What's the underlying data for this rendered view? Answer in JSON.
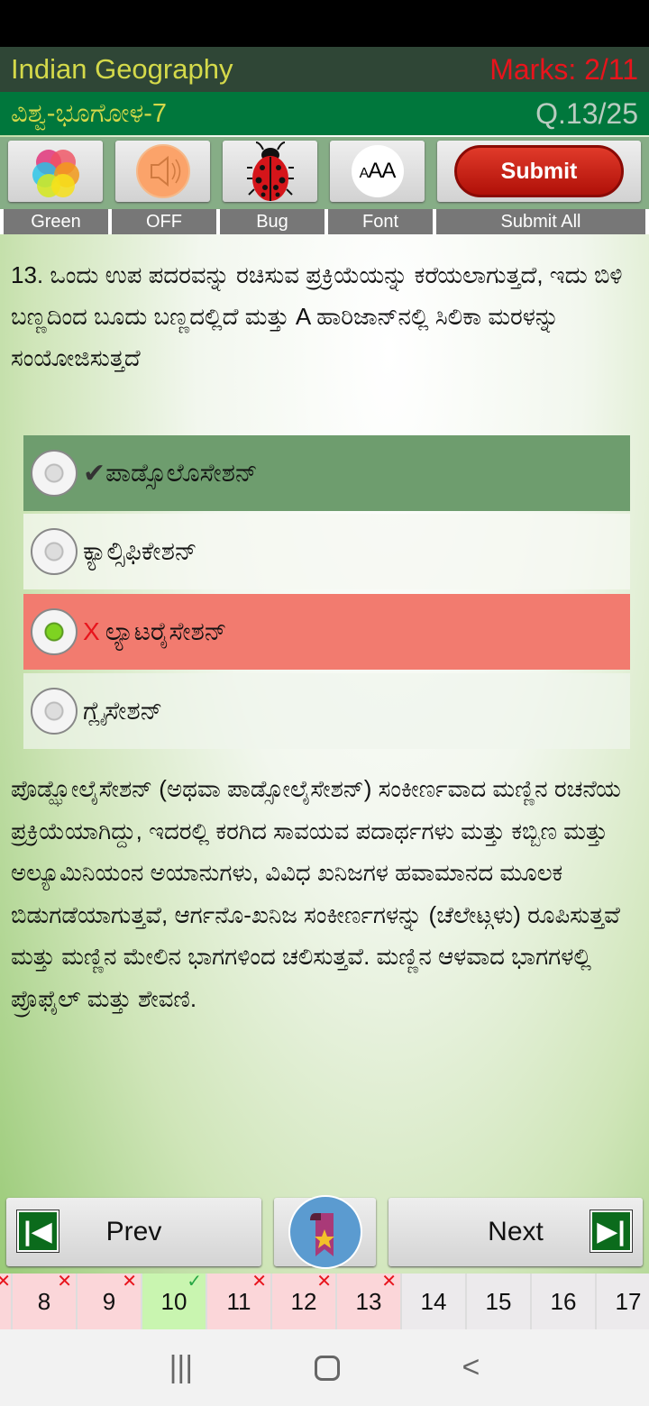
{
  "header": {
    "app_title": "Indian Geography",
    "marks": "Marks: 2/11",
    "subtitle": "ವಿಶ್ವ-ಭೂಗೋಳ-7",
    "question_counter": "Q.13/25"
  },
  "toolbar": {
    "items": [
      {
        "icon": "color-palette-icon",
        "label": "Green"
      },
      {
        "icon": "speaker-icon",
        "label": "OFF"
      },
      {
        "icon": "ladybug-icon",
        "label": "Bug"
      },
      {
        "icon": "font-size-icon",
        "icon_text": "AAA",
        "label": "Font"
      },
      {
        "button": "Submit",
        "label": "Submit All"
      }
    ]
  },
  "question": {
    "text": "13. ಒಂದು ಉಪ ಪದರವನ್ನು ರಚಿಸುವ ಪ್ರಕ್ರಿಯೆಯನ್ನು ಕರೆಯಲಾಗುತ್ತದೆ, ಇದು ಬಿಳಿ ಬಣ್ಣದಿಂದ ಬೂದು ಬಣ್ಣದಲ್ಲಿದೆ ಮತ್ತು A ಹಾರಿಜಾನ್‌ನಲ್ಲಿ ಸಿಲಿಕಾ ಮರಳನ್ನು ಸಂಯೋಜಿಸುತ್ತದೆ"
  },
  "options": [
    {
      "text": "ಪಾಡ್ಸೊಲೊಸೇಶನ್",
      "state": "correct",
      "marker": "✔",
      "selected": false
    },
    {
      "text": "ಕ್ಯಾಲ್ಸಿಫಿಕೇಶನ್",
      "state": "neutral",
      "marker": "",
      "selected": false
    },
    {
      "text": "ಲ್ಯಾಟರೈಸೇಶನ್",
      "state": "wrong",
      "marker": "X",
      "selected": true
    },
    {
      "text": "ಗ್ಲೈಸೇಶನ್",
      "state": "neutral",
      "marker": "",
      "selected": false
    }
  ],
  "explanation": "ಪೊಡ್ಝೋಲೈಸೇಶನ್ (ಅಥವಾ ಪಾಡ್ಸೋಲೈಸೇಶನ್) ಸಂಕೀರ್ಣವಾದ ಮಣ್ಣಿನ ರಚನೆಯ ಪ್ರಕ್ರಿಯೆಯಾಗಿದ್ದು, ಇದರಲ್ಲಿ ಕರಗಿದ ಸಾವಯವ ಪದಾರ್ಥಗಳು ಮತ್ತು ಕಬ್ಬಿಣ ಮತ್ತು ಅಲ್ಯೂಮಿನಿಯಂನ ಅಯಾನುಗಳು, ವಿವಿಧ ಖನಿಜಗಳ ಹವಾಮಾನದ ಮೂಲಕ ಬಿಡುಗಡೆಯಾಗುತ್ತವೆ, ಆರ್ಗನೊ-ಖನಿಜ ಸಂಕೀರ್ಣಗಳನ್ನು (ಚೆಲೇಟ್ಗಳು) ರೂಪಿಸುತ್ತವೆ ಮತ್ತು ಮಣ್ಣಿನ ಮೇಲಿನ ಭಾಗಗಳಿಂದ ಚಲಿಸುತ್ತವೆ. ಮಣ್ಣಿನ ಆಳವಾದ ಭಾಗಗಳಲ್ಲಿ ಪ್ರೊಫೈಲ್ ಮತ್ತು ಶೇವಣಿ.",
  "nav": {
    "prev": "Prev",
    "next": "Next",
    "bookmark_icon": "bookmark-star-icon"
  },
  "question_strip": [
    {
      "n": "8",
      "status": "wrong"
    },
    {
      "n": "9",
      "status": "wrong"
    },
    {
      "n": "10",
      "status": "right"
    },
    {
      "n": "11",
      "status": "wrong"
    },
    {
      "n": "12",
      "status": "wrong"
    },
    {
      "n": "13",
      "status": "wrong"
    },
    {
      "n": "14",
      "status": "none"
    },
    {
      "n": "15",
      "status": "none"
    },
    {
      "n": "16",
      "status": "none"
    },
    {
      "n": "17",
      "status": "none"
    }
  ],
  "colors": {
    "correct": "#6e9d6e",
    "wrong": "#f27b6f",
    "header": "#2f4636",
    "subheader": "#00773c",
    "marks": "#e8141c"
  }
}
